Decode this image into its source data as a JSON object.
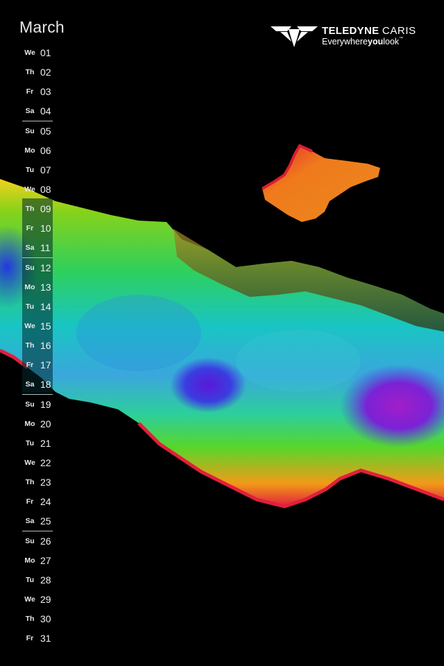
{
  "calendar": {
    "month": "March",
    "days": [
      {
        "dow": "We",
        "num": "01"
      },
      {
        "dow": "Th",
        "num": "02"
      },
      {
        "dow": "Fr",
        "num": "03"
      },
      {
        "dow": "Sa",
        "num": "04"
      },
      {
        "dow": "Su",
        "num": "05"
      },
      {
        "dow": "Mo",
        "num": "06"
      },
      {
        "dow": "Tu",
        "num": "07"
      },
      {
        "dow": "We",
        "num": "08"
      },
      {
        "dow": "Th",
        "num": "09"
      },
      {
        "dow": "Fr",
        "num": "10"
      },
      {
        "dow": "Sa",
        "num": "11"
      },
      {
        "dow": "Su",
        "num": "12"
      },
      {
        "dow": "Mo",
        "num": "13"
      },
      {
        "dow": "Tu",
        "num": "14"
      },
      {
        "dow": "We",
        "num": "15"
      },
      {
        "dow": "Th",
        "num": "16"
      },
      {
        "dow": "Fr",
        "num": "17"
      },
      {
        "dow": "Sa",
        "num": "18"
      },
      {
        "dow": "Su",
        "num": "19"
      },
      {
        "dow": "Mo",
        "num": "20"
      },
      {
        "dow": "Tu",
        "num": "21"
      },
      {
        "dow": "We",
        "num": "22"
      },
      {
        "dow": "Th",
        "num": "23"
      },
      {
        "dow": "Fr",
        "num": "24"
      },
      {
        "dow": "Sa",
        "num": "25"
      },
      {
        "dow": "Su",
        "num": "26"
      },
      {
        "dow": "Mo",
        "num": "27"
      },
      {
        "dow": "Tu",
        "num": "28"
      },
      {
        "dow": "We",
        "num": "29"
      },
      {
        "dow": "Th",
        "num": "30"
      },
      {
        "dow": "Fr",
        "num": "31"
      }
    ]
  },
  "logo": {
    "brand_bold": "TELEDYNE",
    "brand_light": "CARIS",
    "tag_pre": "Everywhere",
    "tag_bold": "you",
    "tag_post": "look",
    "tm": "™",
    "icon": "teledyne-chevron-logo-icon"
  },
  "image": {
    "subject": "multibeam-bathymetry-terrain",
    "background": "#000000"
  }
}
